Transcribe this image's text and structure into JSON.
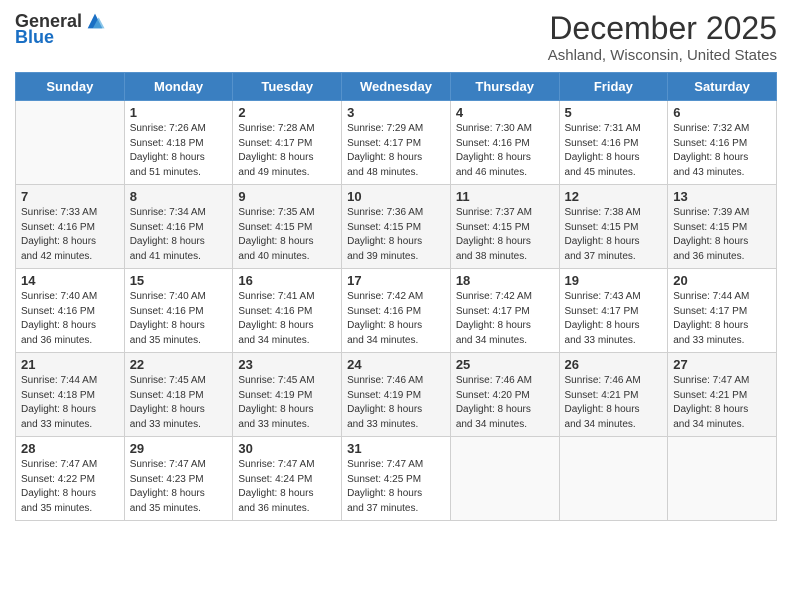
{
  "header": {
    "logo_general": "General",
    "logo_blue": "Blue",
    "month_title": "December 2025",
    "location": "Ashland, Wisconsin, United States"
  },
  "weekdays": [
    "Sunday",
    "Monday",
    "Tuesday",
    "Wednesday",
    "Thursday",
    "Friday",
    "Saturday"
  ],
  "weeks": [
    [
      {
        "day": "",
        "info": ""
      },
      {
        "day": "1",
        "info": "Sunrise: 7:26 AM\nSunset: 4:18 PM\nDaylight: 8 hours\nand 51 minutes."
      },
      {
        "day": "2",
        "info": "Sunrise: 7:28 AM\nSunset: 4:17 PM\nDaylight: 8 hours\nand 49 minutes."
      },
      {
        "day": "3",
        "info": "Sunrise: 7:29 AM\nSunset: 4:17 PM\nDaylight: 8 hours\nand 48 minutes."
      },
      {
        "day": "4",
        "info": "Sunrise: 7:30 AM\nSunset: 4:16 PM\nDaylight: 8 hours\nand 46 minutes."
      },
      {
        "day": "5",
        "info": "Sunrise: 7:31 AM\nSunset: 4:16 PM\nDaylight: 8 hours\nand 45 minutes."
      },
      {
        "day": "6",
        "info": "Sunrise: 7:32 AM\nSunset: 4:16 PM\nDaylight: 8 hours\nand 43 minutes."
      }
    ],
    [
      {
        "day": "7",
        "info": "Sunrise: 7:33 AM\nSunset: 4:16 PM\nDaylight: 8 hours\nand 42 minutes."
      },
      {
        "day": "8",
        "info": "Sunrise: 7:34 AM\nSunset: 4:16 PM\nDaylight: 8 hours\nand 41 minutes."
      },
      {
        "day": "9",
        "info": "Sunrise: 7:35 AM\nSunset: 4:15 PM\nDaylight: 8 hours\nand 40 minutes."
      },
      {
        "day": "10",
        "info": "Sunrise: 7:36 AM\nSunset: 4:15 PM\nDaylight: 8 hours\nand 39 minutes."
      },
      {
        "day": "11",
        "info": "Sunrise: 7:37 AM\nSunset: 4:15 PM\nDaylight: 8 hours\nand 38 minutes."
      },
      {
        "day": "12",
        "info": "Sunrise: 7:38 AM\nSunset: 4:15 PM\nDaylight: 8 hours\nand 37 minutes."
      },
      {
        "day": "13",
        "info": "Sunrise: 7:39 AM\nSunset: 4:15 PM\nDaylight: 8 hours\nand 36 minutes."
      }
    ],
    [
      {
        "day": "14",
        "info": "Sunrise: 7:40 AM\nSunset: 4:16 PM\nDaylight: 8 hours\nand 36 minutes."
      },
      {
        "day": "15",
        "info": "Sunrise: 7:40 AM\nSunset: 4:16 PM\nDaylight: 8 hours\nand 35 minutes."
      },
      {
        "day": "16",
        "info": "Sunrise: 7:41 AM\nSunset: 4:16 PM\nDaylight: 8 hours\nand 34 minutes."
      },
      {
        "day": "17",
        "info": "Sunrise: 7:42 AM\nSunset: 4:16 PM\nDaylight: 8 hours\nand 34 minutes."
      },
      {
        "day": "18",
        "info": "Sunrise: 7:42 AM\nSunset: 4:17 PM\nDaylight: 8 hours\nand 34 minutes."
      },
      {
        "day": "19",
        "info": "Sunrise: 7:43 AM\nSunset: 4:17 PM\nDaylight: 8 hours\nand 33 minutes."
      },
      {
        "day": "20",
        "info": "Sunrise: 7:44 AM\nSunset: 4:17 PM\nDaylight: 8 hours\nand 33 minutes."
      }
    ],
    [
      {
        "day": "21",
        "info": "Sunrise: 7:44 AM\nSunset: 4:18 PM\nDaylight: 8 hours\nand 33 minutes."
      },
      {
        "day": "22",
        "info": "Sunrise: 7:45 AM\nSunset: 4:18 PM\nDaylight: 8 hours\nand 33 minutes."
      },
      {
        "day": "23",
        "info": "Sunrise: 7:45 AM\nSunset: 4:19 PM\nDaylight: 8 hours\nand 33 minutes."
      },
      {
        "day": "24",
        "info": "Sunrise: 7:46 AM\nSunset: 4:19 PM\nDaylight: 8 hours\nand 33 minutes."
      },
      {
        "day": "25",
        "info": "Sunrise: 7:46 AM\nSunset: 4:20 PM\nDaylight: 8 hours\nand 34 minutes."
      },
      {
        "day": "26",
        "info": "Sunrise: 7:46 AM\nSunset: 4:21 PM\nDaylight: 8 hours\nand 34 minutes."
      },
      {
        "day": "27",
        "info": "Sunrise: 7:47 AM\nSunset: 4:21 PM\nDaylight: 8 hours\nand 34 minutes."
      }
    ],
    [
      {
        "day": "28",
        "info": "Sunrise: 7:47 AM\nSunset: 4:22 PM\nDaylight: 8 hours\nand 35 minutes."
      },
      {
        "day": "29",
        "info": "Sunrise: 7:47 AM\nSunset: 4:23 PM\nDaylight: 8 hours\nand 35 minutes."
      },
      {
        "day": "30",
        "info": "Sunrise: 7:47 AM\nSunset: 4:24 PM\nDaylight: 8 hours\nand 36 minutes."
      },
      {
        "day": "31",
        "info": "Sunrise: 7:47 AM\nSunset: 4:25 PM\nDaylight: 8 hours\nand 37 minutes."
      },
      {
        "day": "",
        "info": ""
      },
      {
        "day": "",
        "info": ""
      },
      {
        "day": "",
        "info": ""
      }
    ]
  ]
}
